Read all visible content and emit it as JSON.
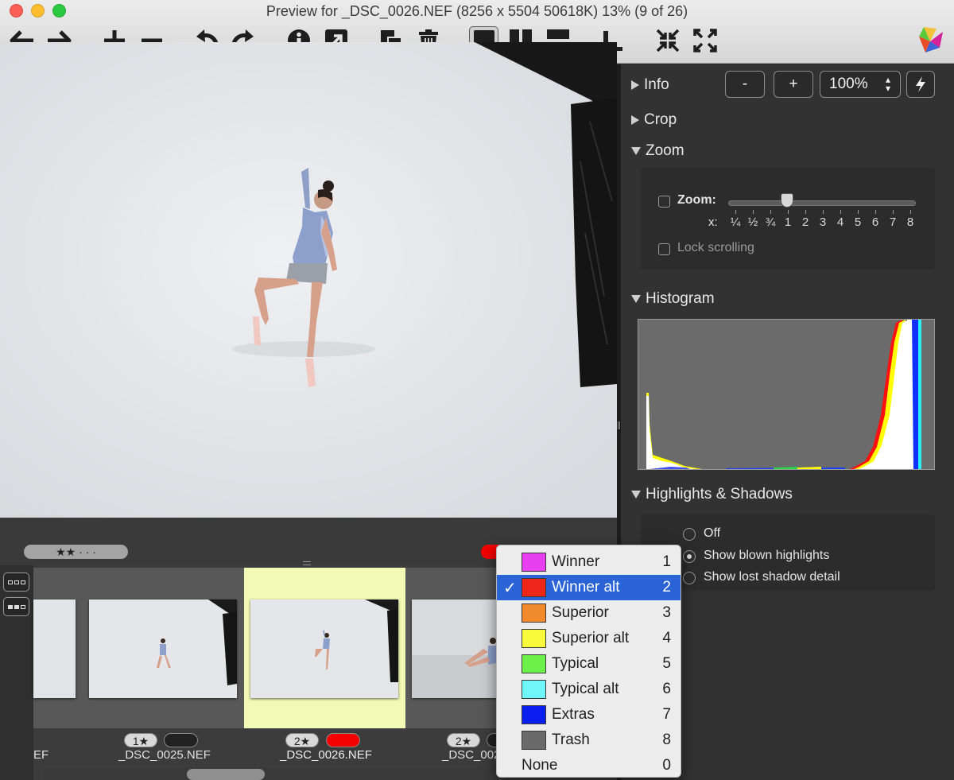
{
  "window": {
    "title": "Preview for _DSC_0026.NEF (8256 x 5504 50618K) 13% (9 of 26)"
  },
  "toolbar": {
    "icons": [
      "arrow-left-icon",
      "arrow-right-icon",
      "plus-icon",
      "minus-icon",
      "rotate-left-icon",
      "rotate-right-icon",
      "info-icon",
      "open-external-icon",
      "duplicate-icon",
      "trash-icon",
      "single-view-icon",
      "side-by-side-icon",
      "stacked-view-icon",
      "align-bottom-icon",
      "collapse-icon",
      "expand-icon"
    ]
  },
  "viewer": {
    "rating_stars": "★★ · · ·"
  },
  "inspector": {
    "sections": {
      "info": "Info",
      "crop": "Crop",
      "zoom": "Zoom",
      "histogram": "Histogram",
      "highlights": "Highlights & Shadows"
    },
    "zoom_controls": {
      "minus": "-",
      "plus": "+",
      "percent": "100%",
      "stepper": "▴▾",
      "lightning": "lightning-icon"
    },
    "zoom_panel": {
      "zoom_label": "Zoom:",
      "x_label": "x:",
      "slider_value": 1,
      "ticks": [
        "¼",
        "½",
        "¾",
        "1",
        "2",
        "3",
        "4",
        "5",
        "6",
        "7",
        "8"
      ],
      "lock_label": "Lock scrolling"
    },
    "hs_options": [
      {
        "label": "Off",
        "selected": false
      },
      {
        "label": "Show blown highlights",
        "selected": true
      },
      {
        "label": "Show lost shadow detail",
        "selected": false
      }
    ]
  },
  "filmstrip": {
    "items": [
      {
        "filename": "EF",
        "rating": "",
        "label_color": ""
      },
      {
        "filename": "_DSC_0025.NEF",
        "rating": "1★",
        "label_color": "#222222"
      },
      {
        "filename": "_DSC_0026.NEF",
        "rating": "2★",
        "label_color": "#f40000"
      },
      {
        "filename": "_DSC_002",
        "rating": "2★",
        "label_color": "#222222"
      }
    ]
  },
  "label_menu": {
    "items": [
      {
        "label": "Winner",
        "key": "1",
        "color": "#e83ff0",
        "checked": false
      },
      {
        "label": "Winner alt",
        "key": "2",
        "color": "#f0261a",
        "checked": true
      },
      {
        "label": "Superior",
        "key": "3",
        "color": "#f08a2c",
        "checked": false
      },
      {
        "label": "Superior alt",
        "key": "4",
        "color": "#fafa3c",
        "checked": false
      },
      {
        "label": "Typical",
        "key": "5",
        "color": "#6ef04a",
        "checked": false
      },
      {
        "label": "Typical alt",
        "key": "6",
        "color": "#6ef6f8",
        "checked": false
      },
      {
        "label": "Extras",
        "key": "7",
        "color": "#0a1ef0",
        "checked": false
      },
      {
        "label": "Trash",
        "key": "8",
        "color": "#6a6a6a",
        "checked": false
      },
      {
        "label": "None",
        "key": "0",
        "color": "",
        "checked": false
      }
    ],
    "check_glyph": "✓"
  }
}
